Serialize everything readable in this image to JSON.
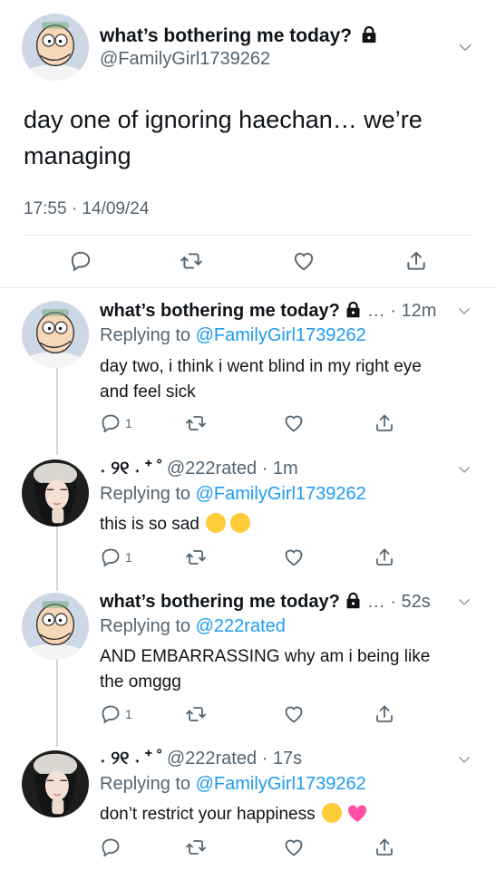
{
  "main_tweet": {
    "display_name": "what’s bothering me today?",
    "handle": "@FamilyGirl1739262",
    "text_line1": "day one of ignoring haechan… we’re",
    "text_line2": "managing",
    "timestamp": "17:55 · 14/09/24"
  },
  "replies": [
    {
      "display_name": "what’s bothering me today?",
      "time": "… · 12m",
      "replying_prefix": "Replying to ",
      "replying_to": "@FamilyGirl1739262",
      "text_line1": "day two, i think i went blind in my right eye",
      "text_line2": "and feel sick",
      "reply_count": "1"
    },
    {
      "display_name": "˖ ୨୧ ˖ ⁺ ˚",
      "handle_time": "@222rated · 1m",
      "replying_prefix": "Replying to ",
      "replying_to": "@FamilyGirl1739262",
      "text_line1": "this is so sad",
      "reply_count": "1"
    },
    {
      "display_name": "what’s bothering me today?",
      "time": "… · 52s",
      "replying_prefix": "Replying to ",
      "replying_to": "@222rated",
      "text_line1": "AND EMBARRASSING why am i being like",
      "text_line2": "the omggg",
      "reply_count": "1"
    },
    {
      "display_name": "˖ ୨୧ ˖ ⁺ ˚",
      "handle_time": "@222rated · 17s",
      "replying_prefix": "Replying to ",
      "replying_to": "@FamilyGirl1739262",
      "text_line1": "don’t restrict your happiness"
    }
  ],
  "icons": [
    "lock-icon",
    "chevron-down-icon",
    "reply-icon",
    "retweet-icon",
    "like-icon",
    "share-icon",
    "crying-emoji",
    "persevering-emoji",
    "pink-heart-emoji"
  ],
  "colors": {
    "link": "#1d9bf0",
    "secondary_text": "#536471",
    "heart_emoji": "#ff4fa3"
  }
}
